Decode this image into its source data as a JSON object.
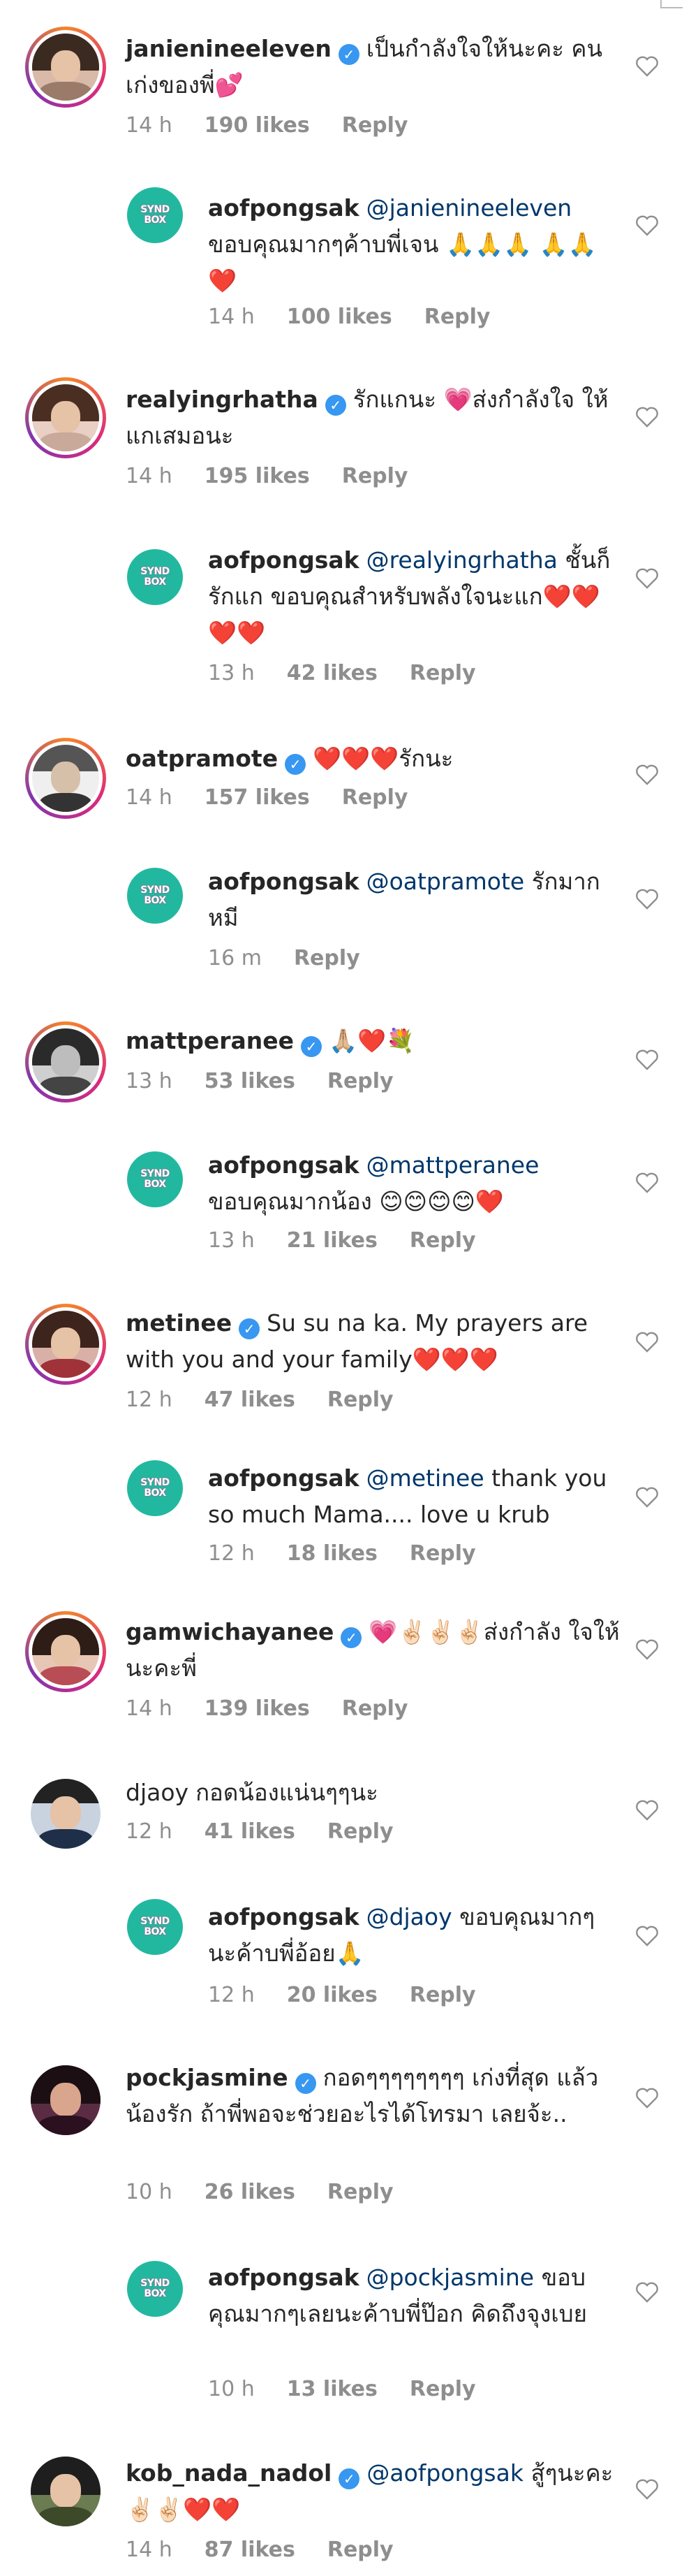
{
  "comments": [
    {
      "user": "janienineeleven",
      "verified": true,
      "text": "เป็นกำลังใจให้นะคะ คนเก่งของพี่💕",
      "time": "14 h",
      "likes": "190 likes",
      "reply": "Reply"
    },
    {
      "user": "aofpongsak",
      "verified": false,
      "mention": "@janienineeleven",
      "text": "ขอบคุณมากๆค้าบพี่เจน 🙏🙏🙏 🙏🙏❤️",
      "time": "14 h",
      "likes": "100 likes",
      "reply": "Reply",
      "is_reply": true
    },
    {
      "user": "realyingrhatha",
      "verified": true,
      "text": "รักแกนะ 💗ส่งกำลังใจ ให้แกเสมอนะ",
      "time": "14 h",
      "likes": "195 likes",
      "reply": "Reply"
    },
    {
      "user": "aofpongsak",
      "verified": false,
      "mention": "@realyingrhatha",
      "text": "ชั้นก็รักแก ขอบคุณสำหรับพลังใจนะแก❤️❤️❤️❤️",
      "time": "13 h",
      "likes": "42 likes",
      "reply": "Reply",
      "is_reply": true
    },
    {
      "user": "oatpramote",
      "verified": true,
      "text": "❤️❤️❤️รักนะ",
      "time": "14 h",
      "likes": "157 likes",
      "reply": "Reply"
    },
    {
      "user": "aofpongsak",
      "verified": false,
      "mention": "@oatpramote",
      "text": "รักมากหมี",
      "time": "16 m",
      "likes": "",
      "reply": "Reply",
      "is_reply": true
    },
    {
      "user": "mattperanee",
      "verified": true,
      "text": "🙏🏼❤️💐",
      "time": "13 h",
      "likes": "53 likes",
      "reply": "Reply"
    },
    {
      "user": "aofpongsak",
      "verified": false,
      "mention": "@mattperanee",
      "text": "ขอบคุณมากน้อง 😊😊😊😊❤️",
      "time": "13 h",
      "likes": "21 likes",
      "reply": "Reply",
      "is_reply": true
    },
    {
      "user": "metinee",
      "verified": true,
      "text": "Su su na ka. My prayers are with you and your family❤️❤️❤️",
      "time": "12 h",
      "likes": "47 likes",
      "reply": "Reply"
    },
    {
      "user": "aofpongsak",
      "verified": false,
      "mention": "@metinee",
      "text": "thank you so much Mama.... love u krub",
      "time": "12 h",
      "likes": "18 likes",
      "reply": "Reply",
      "is_reply": true
    },
    {
      "user": "gamwichayanee",
      "verified": true,
      "text": "💗✌🏻✌🏻✌🏻ส่งกำลัง ใจให้นะคะพี่",
      "time": "14 h",
      "likes": "139 likes",
      "reply": "Reply"
    },
    {
      "user": "djaoy",
      "verified": false,
      "text": "กอดน้องแน่นๆๆนะ",
      "time": "12 h",
      "likes": "41 likes",
      "reply": "Reply"
    },
    {
      "user": "aofpongsak",
      "verified": false,
      "mention": "@djaoy",
      "text": "ขอบคุณมากๆนะค้าบพี่อ้อย🙏",
      "time": "12 h",
      "likes": "20 likes",
      "reply": "Reply",
      "is_reply": true
    },
    {
      "user": "pockjasmine",
      "verified": true,
      "text": "กอดๆๆๆๆๆๆๆๆ เก่งที่สุด แล้วน้องรัก ถ้าพี่พอจะช่วยอะไรได้โทรมา เลยจ้ะ..",
      "time": "10 h",
      "likes": "26 likes",
      "reply": "Reply"
    },
    {
      "user": "aofpongsak",
      "verified": false,
      "mention": "@pockjasmine",
      "text": "ขอบคุณมากๆเลยนะค้าบพี่ป๊อก คิดถึงจุงเบย",
      "time": "10 h",
      "likes": "13 likes",
      "reply": "Reply",
      "is_reply": true
    },
    {
      "user": "kob_nada_nadol",
      "verified": true,
      "mention": "@aofpongsak",
      "text": "สู้ๆนะคะ✌🏻✌🏻❤️❤️",
      "time": "14 h",
      "likes": "87 likes",
      "reply": "Reply"
    }
  ],
  "logo_text": "SYNDROME\nBOX",
  "icons": {
    "heart": "heart-outline-icon",
    "verified": "verified-badge-icon"
  },
  "colors": {
    "username": "#262626",
    "meta": "#8e8e8e",
    "mention": "#00376b",
    "verified": "#3897f0",
    "logo": "#22b8a0"
  }
}
